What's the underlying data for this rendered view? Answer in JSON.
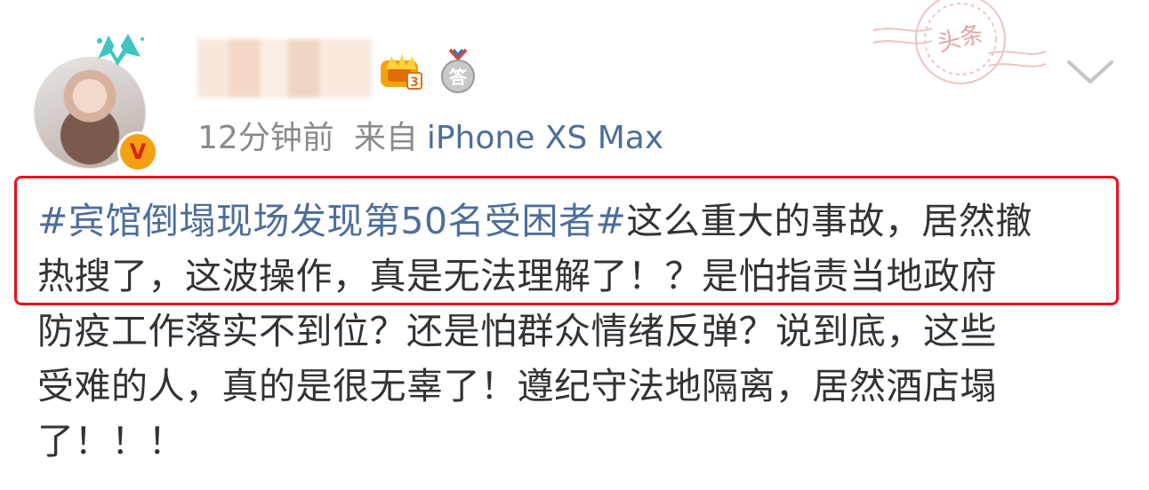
{
  "post": {
    "meta": {
      "time": "12分钟前",
      "source_label": "来自",
      "device": "iPhone XS Max"
    },
    "badges": {
      "answer_badge_text": "答",
      "stamp_text": "头条",
      "crown_level": "3"
    },
    "body": {
      "hashtag": "#宾馆倒塌现场发现第50名受困者#",
      "line1_rest": "这么重大的事故，居然撤",
      "line2": "热搜了，这波操作，真是无法理解了！？是怕指责当地政府",
      "line3": "防疫工作落实不到位？还是怕群众情绪反弹？说到底，这些",
      "line4": "受难的人，真的是很无辜了！遵纪守法地隔离，居然酒店塌",
      "line5": "了！！！"
    }
  },
  "colors": {
    "link": "#4d6e9b",
    "meta": "#8b8b8b",
    "highlight_border": "#e8121f",
    "verified_badge": "#f3a112"
  }
}
